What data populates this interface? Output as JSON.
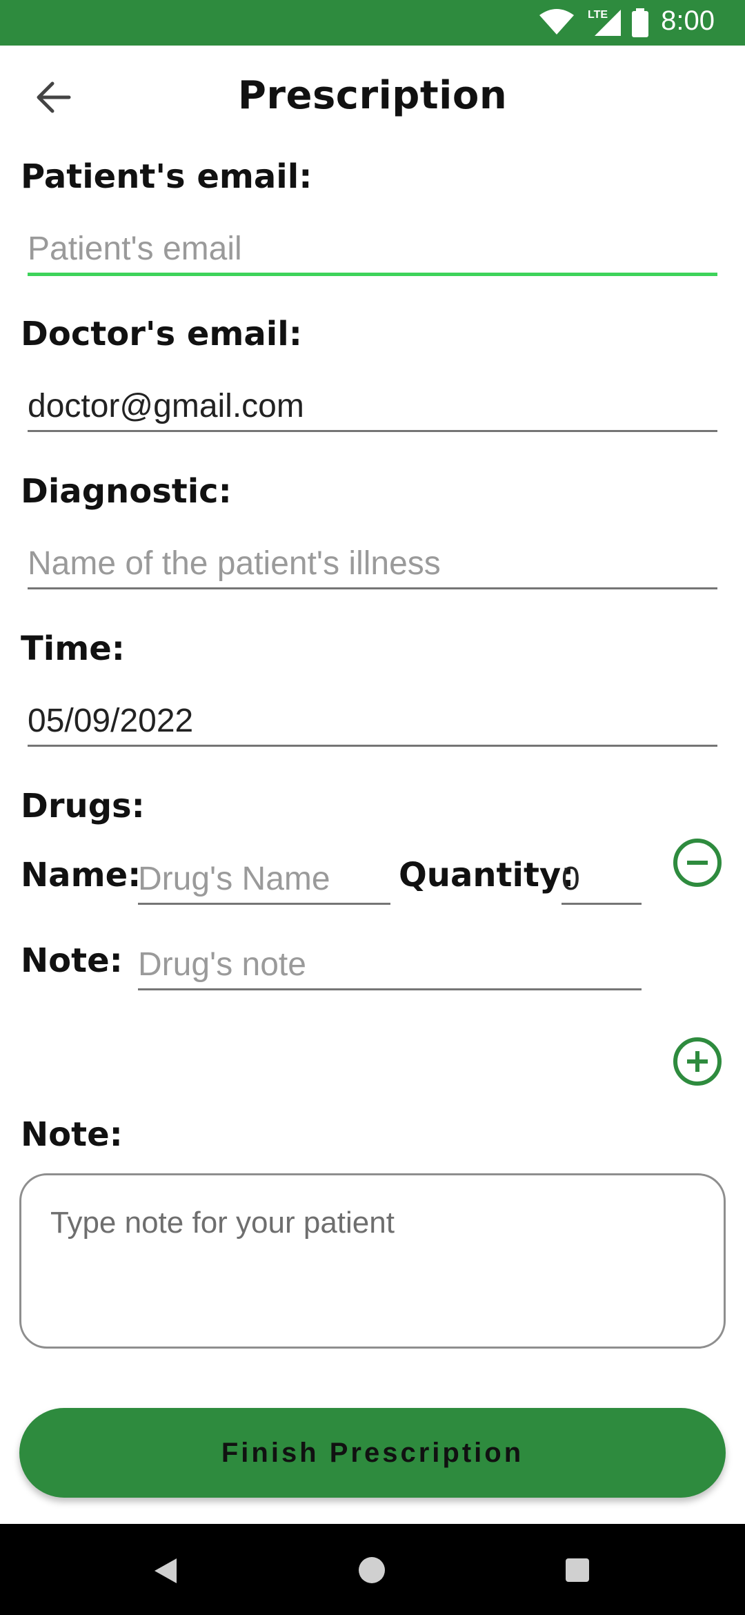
{
  "status_bar": {
    "time": "8:00",
    "network": "LTE"
  },
  "app_bar": {
    "title": "Prescription"
  },
  "form": {
    "patient_email": {
      "label": "Patient's email:",
      "value": "",
      "placeholder": "Patient's email"
    },
    "doctor_email": {
      "label": "Doctor's email:",
      "value": "doctor@gmail.com",
      "placeholder": ""
    },
    "diagnostic": {
      "label": "Diagnostic:",
      "value": "",
      "placeholder": "Name of the patient's illness"
    },
    "time": {
      "label": "Time:",
      "value": "05/09/2022",
      "placeholder": ""
    },
    "drugs": {
      "label": "Drugs:",
      "items": [
        {
          "name_label": "Name:",
          "name_value": "",
          "name_placeholder": "Drug's Name",
          "quantity_label": "Quantity:",
          "quantity_value": "0",
          "note_label": "Note:",
          "note_value": "",
          "note_placeholder": "Drug's note"
        }
      ]
    },
    "note": {
      "label": "Note:",
      "value": "",
      "placeholder": "Type note for your patient"
    }
  },
  "actions": {
    "finish_label": "Finish Prescription"
  },
  "colors": {
    "primary": "#2e8b3e",
    "focus_underline": "#3dd35a"
  }
}
